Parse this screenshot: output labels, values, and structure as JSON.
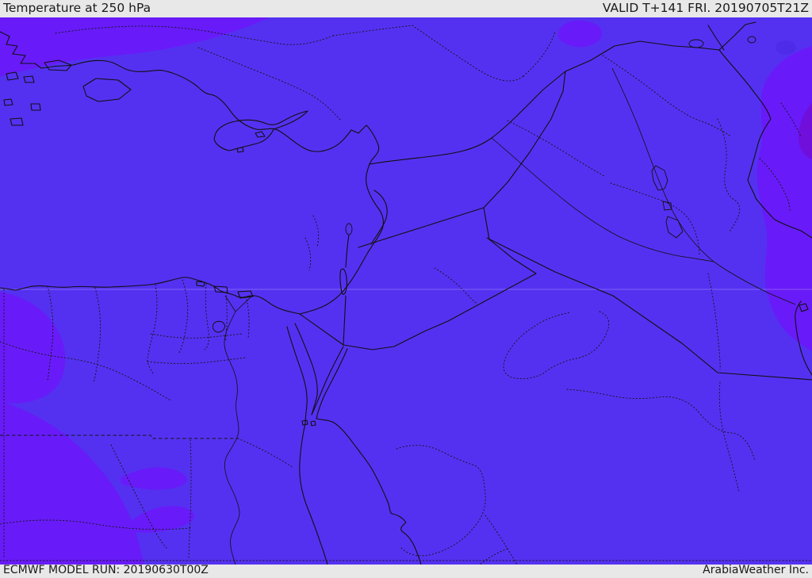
{
  "header": {
    "title": "Temperature at 250 hPa",
    "valid_label": "VALID T+141 FRI. 20190705T21Z"
  },
  "footer": {
    "model_run_label": "ECMWF MODEL RUN: 20190630T00Z",
    "branding_label": "ArabiaWeather Inc."
  },
  "map": {
    "parameter": "Temperature at 250 hPa",
    "colors": {
      "bar_background": "#e8e8e8",
      "text": "#1a1a1a",
      "base_fill": "#5431F1",
      "warm_band_fill": "#681BF8",
      "warmer_corner_fill": "#700FDC",
      "cool_blob_fill": "#4E2BE9",
      "border_line": "#101010"
    }
  }
}
